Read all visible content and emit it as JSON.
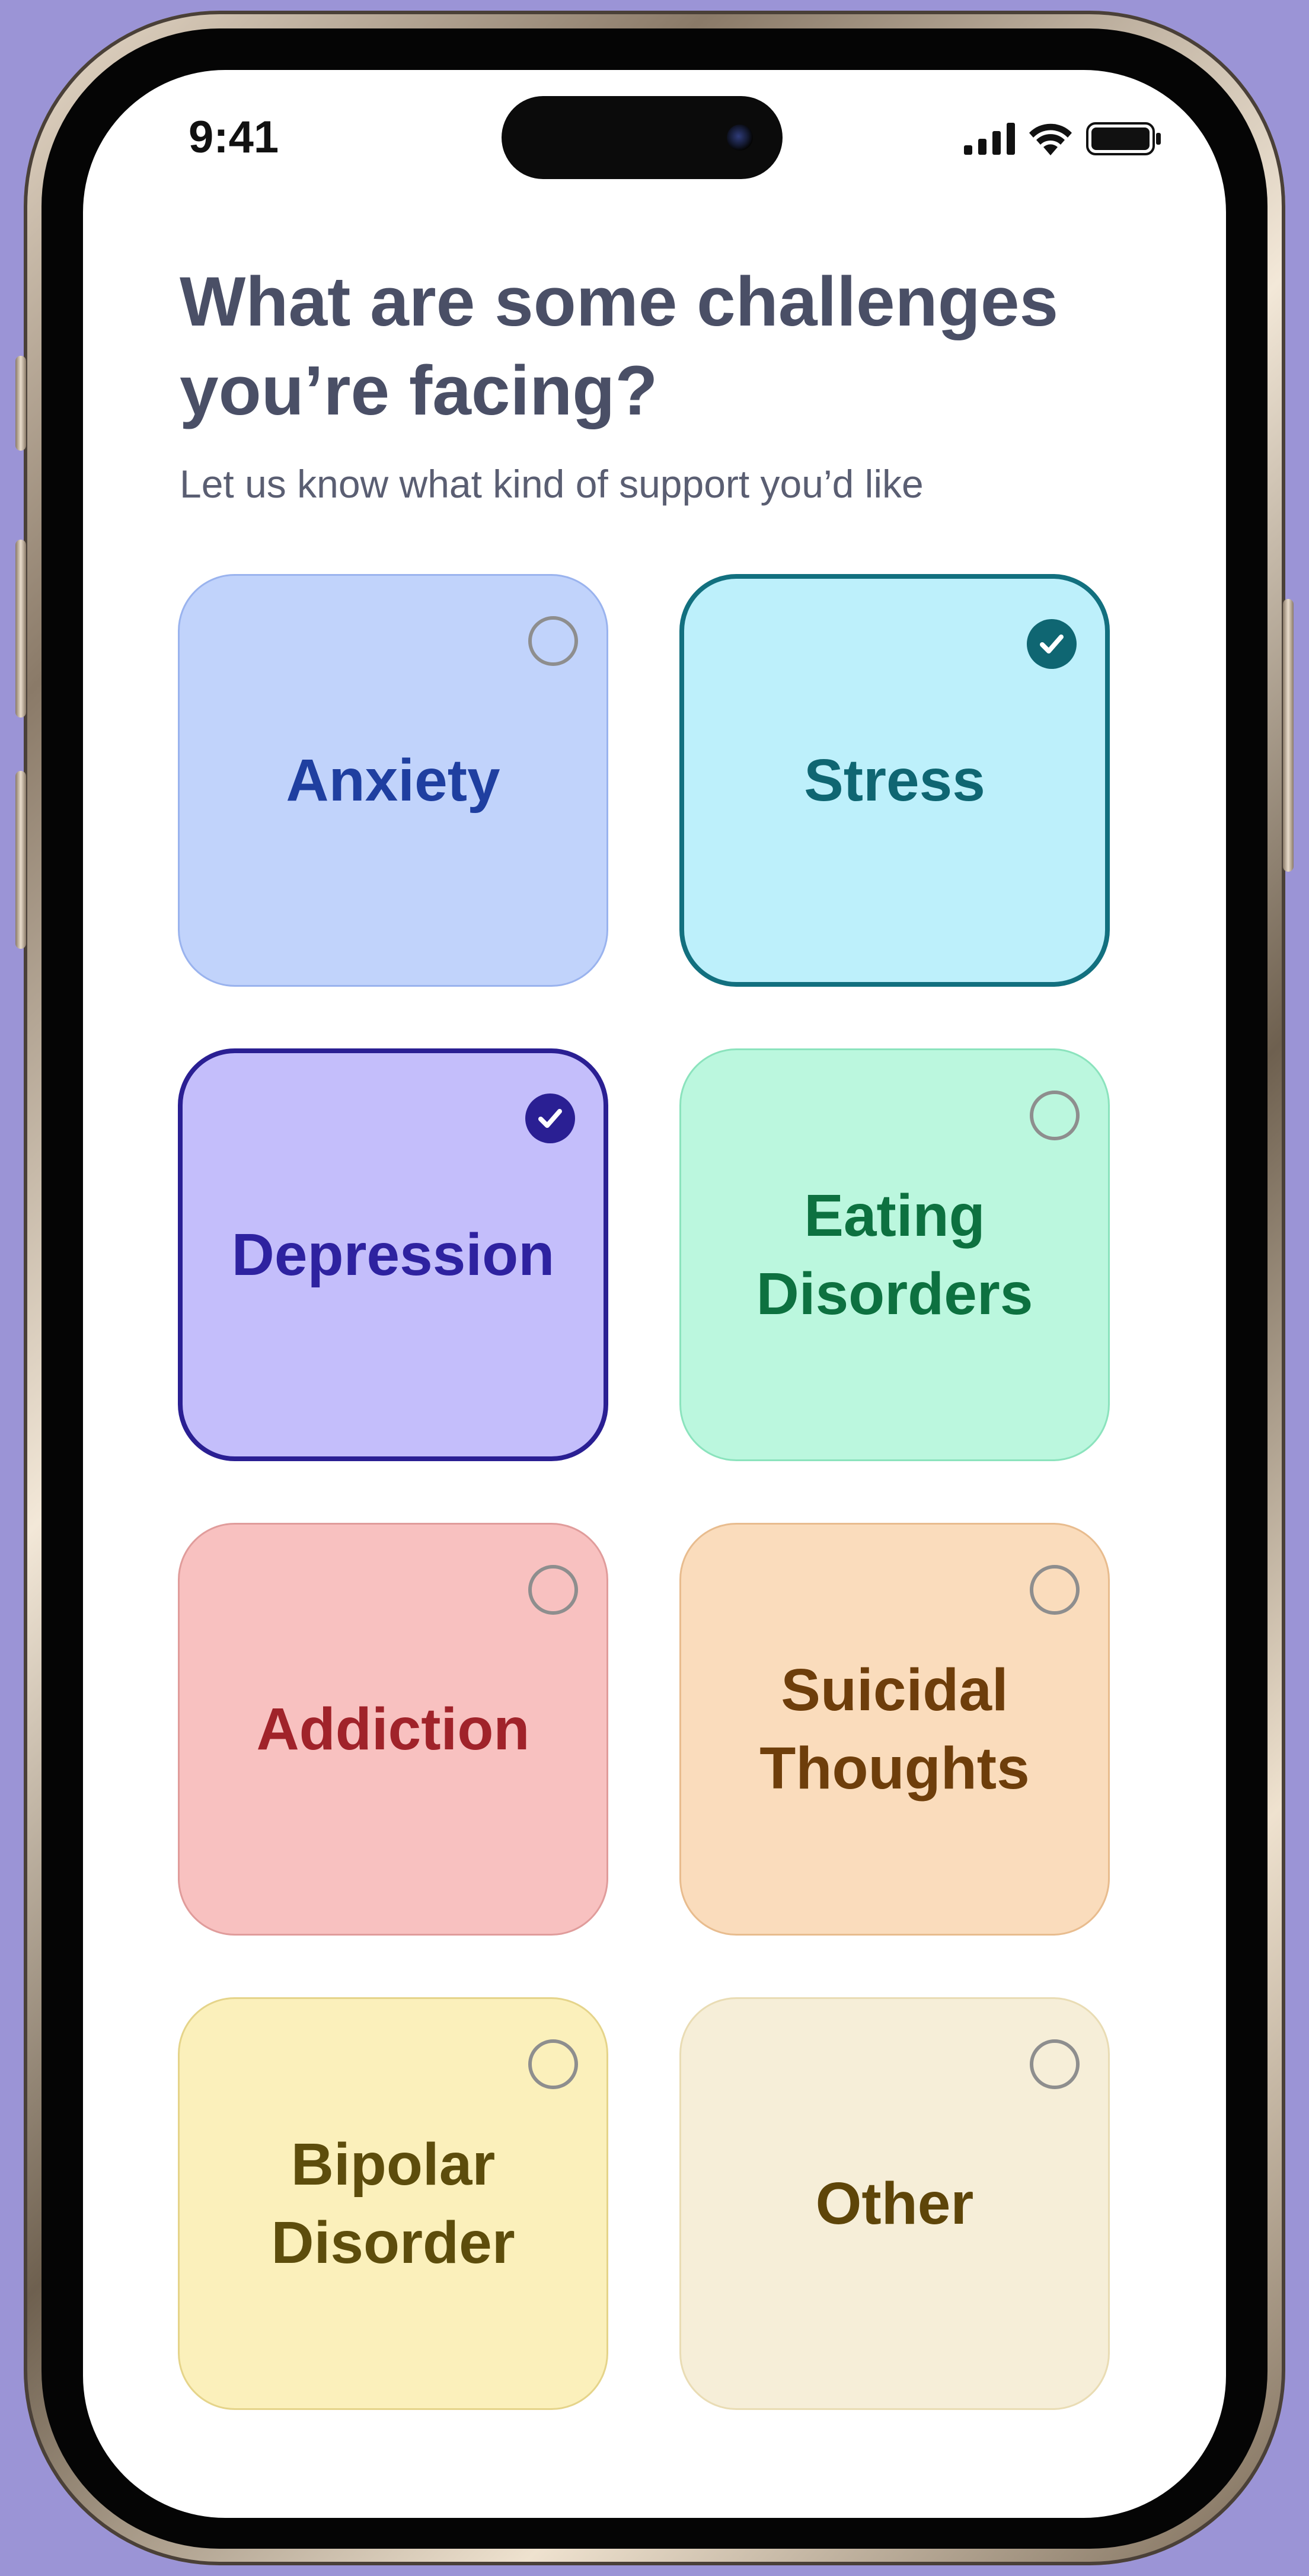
{
  "status_bar": {
    "time": "9:41"
  },
  "header": {
    "title": "What are some challenges you’re facing?",
    "subtitle": "Let us know what kind of support you’d like"
  },
  "challenges": [
    {
      "label": "Anxiety",
      "selected": false,
      "bg": "#c1d3fb",
      "border": "#9ab3ee",
      "text": "#1f3fa0",
      "check": "#1f3fa0"
    },
    {
      "label": "Stress",
      "selected": true,
      "bg": "#bdf0fb",
      "border": "#12707f",
      "text": "#0f6672",
      "check": "#0f6672"
    },
    {
      "label": "Depression",
      "selected": true,
      "bg": "#c4befb",
      "border": "#2a1f93",
      "text": "#2e22a0",
      "check": "#2a1f93"
    },
    {
      "label": "Eating Disorders",
      "selected": false,
      "bg": "#bbf7de",
      "border": "#8be3bd",
      "text": "#0d7140",
      "check": "#0d7140"
    },
    {
      "label": "Addiction",
      "selected": false,
      "bg": "#f8c1c0",
      "border": "#e09c9b",
      "text": "#a0232a",
      "check": "#a0232a"
    },
    {
      "label": "Suicidal Thoughts",
      "selected": false,
      "bg": "#fadcbc",
      "border": "#e8bc8e",
      "text": "#6e3e0b",
      "check": "#6e3e0b"
    },
    {
      "label": "Bipolar Disorder",
      "selected": false,
      "bg": "#fbf0bb",
      "border": "#e5d48a",
      "text": "#5d4d0c",
      "check": "#5d4d0c"
    },
    {
      "label": "Other",
      "selected": false,
      "bg": "#f6eed8",
      "border": "#e9dcb4",
      "text": "#5e4509",
      "check": "#5e4509"
    }
  ]
}
